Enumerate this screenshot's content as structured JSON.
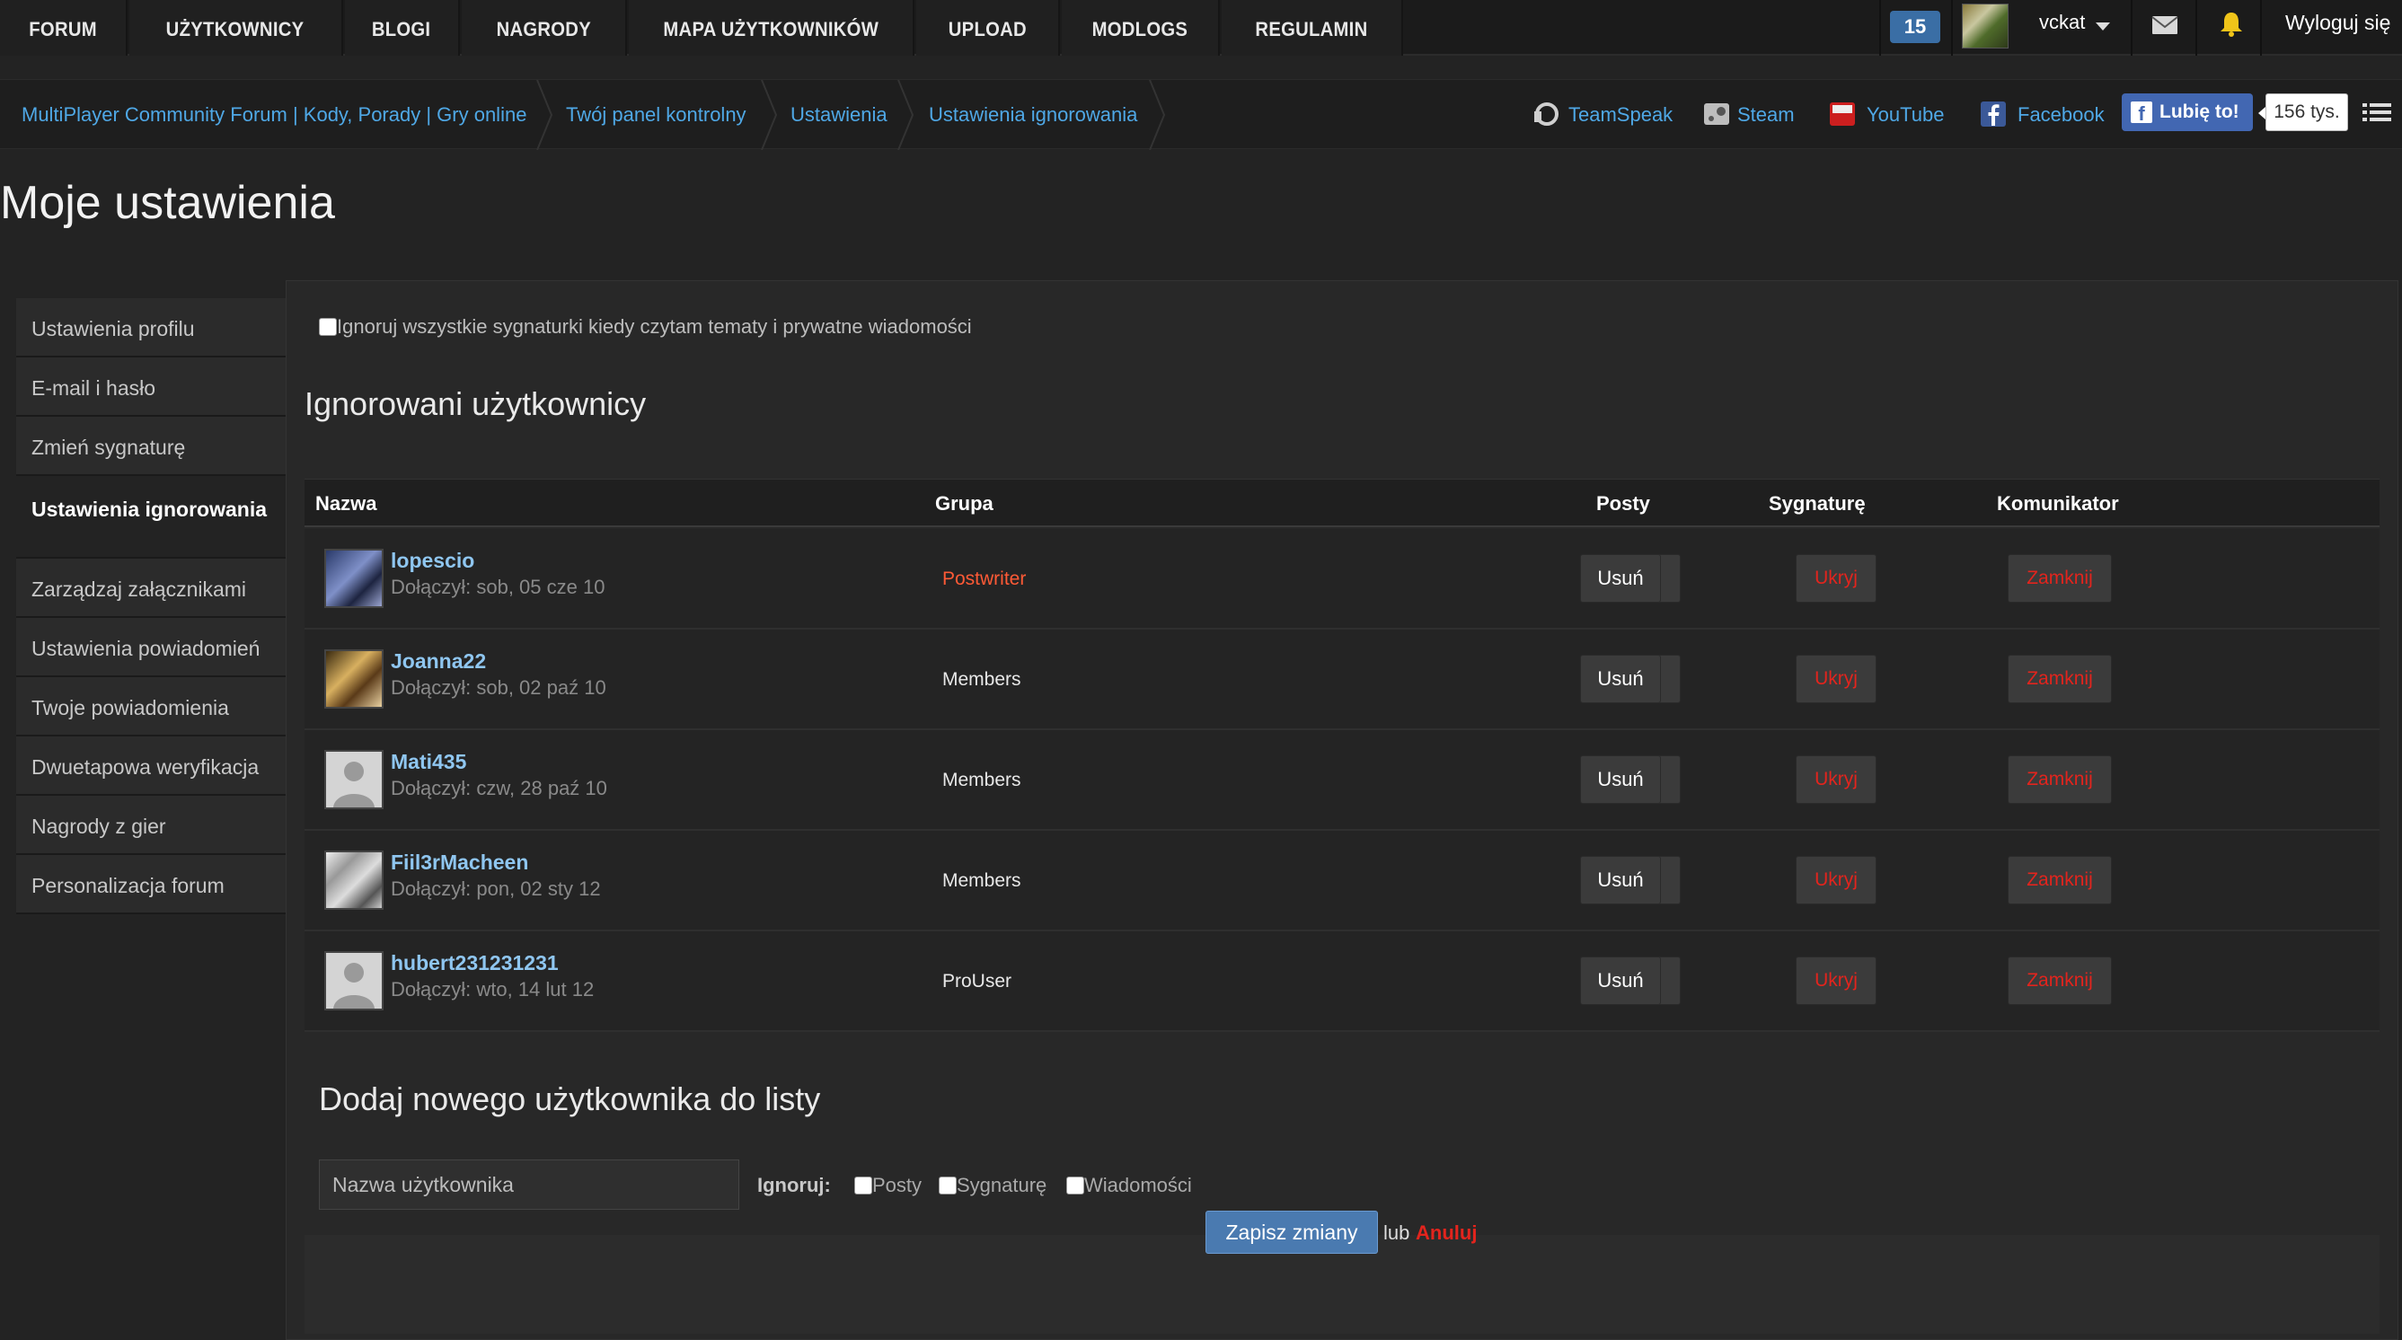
{
  "nav": {
    "tabs": [
      "FORUM",
      "UŻYTKOWNICY",
      "BLOGI",
      "NAGRODY",
      "MAPA UŻYTKOWNIKÓW",
      "UPLOAD",
      "MODLOGS",
      "REGULAMIN"
    ],
    "badge_count": "15",
    "username": "vckat",
    "logout": "Wyloguj się"
  },
  "breadcrumb": [
    "MultiPlayer Community Forum | Kody, Porady | Gry online",
    "Twój panel kontrolny",
    "Ustawienia",
    "Ustawienia ignorowania"
  ],
  "social": {
    "teamspeak": "TeamSpeak",
    "steam": "Steam",
    "youtube": "YouTube",
    "facebook": "Facebook",
    "like_label": "Lubię to!",
    "like_count": "156 tys."
  },
  "page_title": "Moje ustawienia",
  "sidebar": {
    "items": [
      "Ustawienia profilu",
      "E-mail i hasło",
      "Zmień sygnaturę",
      "Ustawienia ignorowania",
      "Zarządzaj załącznikami",
      "Ustawienia powiadomień",
      "Twoje powiadomienia",
      "Dwuetapowa weryfikacja",
      "Nagrody z gier",
      "Personalizacja forum"
    ],
    "active_index": 3
  },
  "main": {
    "ignore_all_label": "Ignoruj wszystkie sygnaturki kiedy czytam tematy i prywatne wiadomości",
    "ignored_heading": "Ignorowani użytkownicy",
    "columns": {
      "name": "Nazwa",
      "group": "Grupa",
      "posts": "Posty",
      "signature": "Sygnaturę",
      "messenger": "Komunikator"
    },
    "buttons": {
      "hide": "Ukryj",
      "close": "Zamknij",
      "remove": "Usuń"
    },
    "users": [
      {
        "name": "lopescio",
        "joined": "Dołączył: sob, 05 cze 10",
        "group": "Postwriter"
      },
      {
        "name": "Joanna22",
        "joined": "Dołączył: sob, 02 paź 10",
        "group": "Members"
      },
      {
        "name": "Mati435",
        "joined": "Dołączył: czw, 28 paź 10",
        "group": "Members"
      },
      {
        "name": "Fiil3rMacheen",
        "joined": "Dołączył: pon, 02 sty 12",
        "group": "Members"
      },
      {
        "name": "hubert231231231",
        "joined": "Dołączył: wto, 14 lut 12",
        "group": "ProUser"
      }
    ],
    "add_heading": "Dodaj nowego użytkownika do listy",
    "username_placeholder": "Nazwa użytkownika",
    "ignore_label": "Ignoruj:",
    "ignore_options": [
      "Posty",
      "Sygnaturę",
      "Wiadomości"
    ],
    "save_label": "Zapisz zmiany",
    "or_label": "lub",
    "cancel_label": "Anuluj"
  },
  "colors": {
    "accent_link": "#4fa8e6",
    "danger": "#e3241d",
    "primary_button": "#4a7ab0"
  }
}
